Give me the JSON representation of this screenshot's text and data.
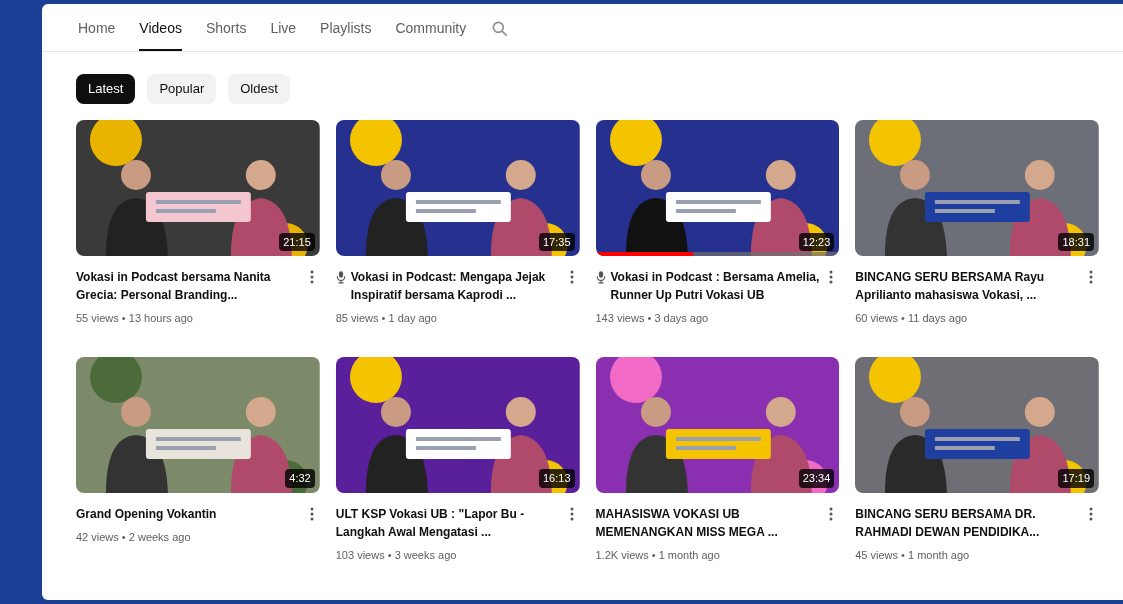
{
  "tabs": [
    {
      "label": "Home",
      "selected": false
    },
    {
      "label": "Videos",
      "selected": true
    },
    {
      "label": "Shorts",
      "selected": false
    },
    {
      "label": "Live",
      "selected": false
    },
    {
      "label": "Playlists",
      "selected": false
    },
    {
      "label": "Community",
      "selected": false
    }
  ],
  "chips": [
    {
      "label": "Latest",
      "selected": true
    },
    {
      "label": "Popular",
      "selected": false
    },
    {
      "label": "Oldest",
      "selected": false
    }
  ],
  "videos": [
    {
      "duration": "21:15",
      "mic_icon": false,
      "title": "Vokasi in Podcast bersama Nanita Grecia: Personal Branding...",
      "meta": "55 views • 13 hours ago"
    },
    {
      "duration": "17:35",
      "mic_icon": true,
      "title": "Vokasi in Podcast: Mengapa Jejak Inspiratif bersama Kaprodi ...",
      "meta": "85 views • 1 day ago"
    },
    {
      "duration": "12:23",
      "mic_icon": true,
      "title": "Vokasi in Podcast : Bersama Amelia, Runner Up Putri Vokasi UB",
      "meta": "143 views • 3 days ago",
      "watched": {
        "level": 0.4
      }
    },
    {
      "duration": "18:31",
      "mic_icon": false,
      "title": "BINCANG SERU BERSAMA Rayu Aprilianto mahasiswa Vokasi, ...",
      "meta": "60 views • 11 days ago"
    },
    {
      "duration": "4:32",
      "mic_icon": false,
      "title": "Grand Opening Vokantin",
      "meta": "42 views • 2 weeks ago"
    },
    {
      "duration": "16:13",
      "mic_icon": false,
      "title": "ULT KSP Vokasi UB : \"Lapor Bu - Langkah Awal Mengatasi ...",
      "meta": "103 views • 3 weeks ago"
    },
    {
      "duration": "23:34",
      "mic_icon": false,
      "title": "MAHASISWA VOKASI UB MEMENANGKAN MISS MEGA ...",
      "meta": "1.2K views • 1 month ago"
    },
    {
      "duration": "17:19",
      "mic_icon": false,
      "title": "BINCANG SERU BERSAMA DR. RAHMADI DEWAN PENDIDIKA...",
      "meta": "45 views • 1 month ago"
    }
  ]
}
